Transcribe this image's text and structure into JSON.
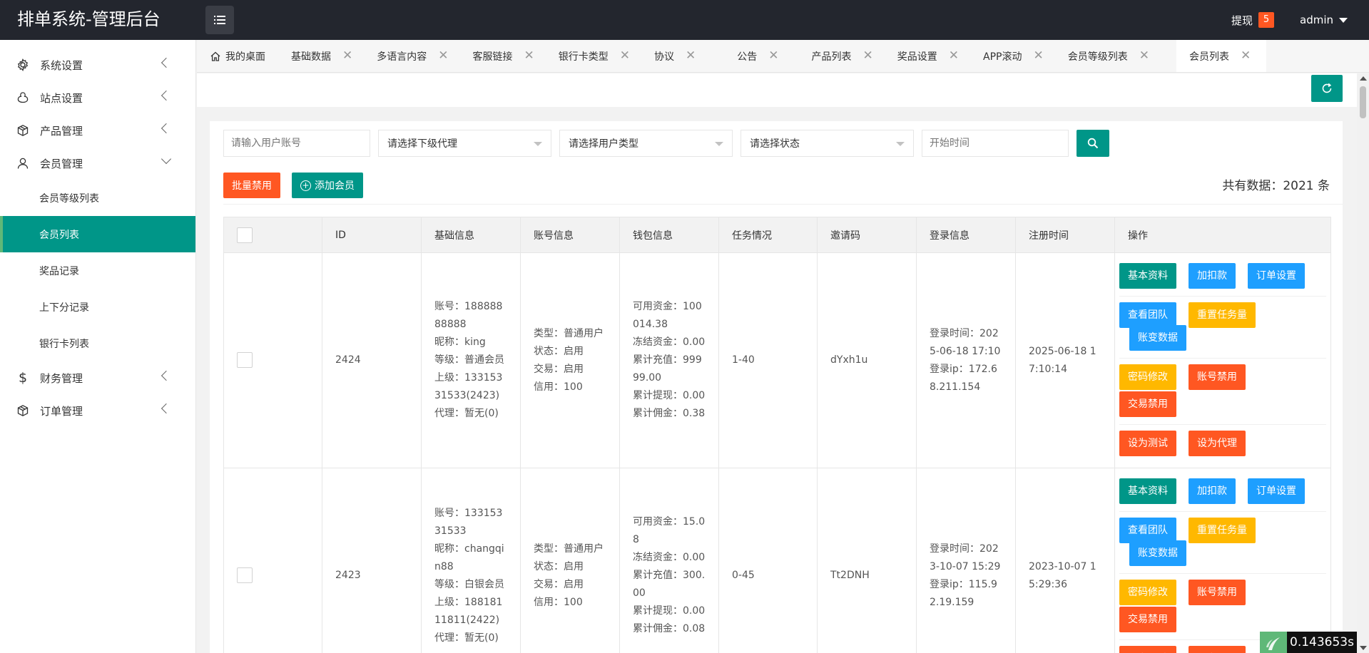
{
  "header": {
    "title": "排单系统-管理后台",
    "withdraw_label": "提现",
    "withdraw_count": "5",
    "user": "admin"
  },
  "sidebar": {
    "items": [
      {
        "label": "系统设置",
        "icon": "gear-icon"
      },
      {
        "label": "站点设置",
        "icon": "site-icon"
      },
      {
        "label": "产品管理",
        "icon": "box-icon"
      },
      {
        "label": "会员管理",
        "icon": "user-icon"
      },
      {
        "label": "财务管理",
        "icon": "dollar-icon"
      },
      {
        "label": "订单管理",
        "icon": "box-icon"
      }
    ],
    "sub_items": [
      "会员等级列表",
      "会员列表",
      "奖品记录",
      "上下分记录",
      "银行卡列表"
    ]
  },
  "tabs": [
    "我的桌面",
    "基础数据",
    "多语言内容",
    "客服链接",
    "银行卡类型",
    "协议",
    "公告",
    "产品列表",
    "奖品设置",
    "APP滚动",
    "会员等级列表",
    "会员列表"
  ],
  "filters": {
    "account_placeholder": "请输入用户账号",
    "agent_select": "请选择下级代理",
    "type_select": "请选择用户类型",
    "status_select": "请选择状态",
    "start_placeholder": "开始时间"
  },
  "actions": {
    "batch_disable": "批量禁用",
    "add_member": "添加会员",
    "total": "共有数据：2021 条"
  },
  "table": {
    "columns": [
      "ID",
      "基础信息",
      "账号信息",
      "钱包信息",
      "任务情况",
      "邀请码",
      "登录信息",
      "注册时间",
      "操作"
    ],
    "rows": [
      {
        "id": "2424",
        "basic": [
          "账号：18888888888",
          "昵称：king",
          "等级：普通会员",
          "上级：13315331533(2423)",
          "代理：暂无(0)"
        ],
        "account": [
          "类型：普通用户",
          "状态：启用",
          "交易：启用",
          "信用：100"
        ],
        "wallet": [
          "可用资金：100014.38",
          "冻结资金：0.00",
          "累计充值：99999.00",
          "累计提现：0.00",
          "累计佣金：0.38"
        ],
        "task": "1-40",
        "invite": "dYxh1u",
        "login": [
          "登录时间：2025-06-18 17:10",
          "登录ip：172.68.211.154"
        ],
        "reg": "2025-06-18 17:10:14"
      },
      {
        "id": "2423",
        "basic": [
          "账号：13315331533",
          "昵称：changqin88",
          "等级：白银会员",
          "上级：18818111811(2422)",
          "代理：暂无(0)"
        ],
        "account": [
          "类型：普通用户",
          "状态：启用",
          "交易：启用",
          "信用：100"
        ],
        "wallet": [
          "可用资金：15.08",
          "冻结资金：0.00",
          "累计充值：300.00",
          "累计提现：0.00",
          "累计佣金：0.08"
        ],
        "task": "0-45",
        "invite": "Tt2DNH",
        "login": [
          "登录时间：2023-10-07 15:29",
          "登录ip：115.92.19.159"
        ],
        "reg": "2023-10-07 15:29:36"
      }
    ],
    "ops": {
      "basic_info": "基本资料",
      "add_deduct": "加扣款",
      "order_settings": "订单设置",
      "view_team": "查看团队",
      "reset_tasks": "重置任务量",
      "account_change": "账变数据",
      "change_pwd": "密码修改",
      "disable_account": "账号禁用",
      "disable_trade": "交易禁用",
      "set_test": "设为测试",
      "set_agent": "设为代理"
    }
  },
  "timer": "0.143653s",
  "colors": {
    "primary": "#009688",
    "danger": "#ff5722",
    "info": "#1e9fff",
    "warning": "#ffb800",
    "header": "#23262e"
  }
}
